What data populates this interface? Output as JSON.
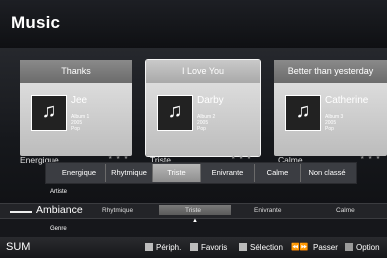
{
  "header": {
    "title": "Music"
  },
  "cards": [
    {
      "title": "Thanks",
      "artist": "Jee",
      "album": "Album 1",
      "year": "2005",
      "genre": "Pop",
      "mood": "Energique",
      "stars": "★ ★ ★"
    },
    {
      "title": "I Love You",
      "artist": "Darby",
      "album": "Album 2",
      "year": "2005",
      "genre": "Pop",
      "mood": "Triste",
      "stars": "★ ★ ★",
      "selected": true
    },
    {
      "title": "Better than yesterday",
      "artist": "Catherine",
      "album": "Album 3",
      "year": "2005",
      "genre": "Pop",
      "mood": "Calme",
      "stars": "★ ★ ★"
    }
  ],
  "mood_popup": {
    "options": [
      "Energique",
      "Rhytmique",
      "Triste",
      "Enivrante",
      "Calme",
      "Non classé"
    ],
    "selected": "Triste"
  },
  "category_selector": {
    "above": "Artiste",
    "current": "Ambiance",
    "below": "Genre",
    "bar_options": [
      "Rhytmique",
      "Triste",
      "Enivrante",
      "Calme"
    ],
    "bar_selected": "Triste",
    "arrow": "▲"
  },
  "footer": {
    "left": "SUM",
    "hints": [
      {
        "icon": "red-button-icon",
        "label": "Périph."
      },
      {
        "icon": "green-button-icon",
        "label": "Favoris"
      },
      {
        "icon": "yellow-button-icon",
        "label": "Sélection"
      },
      {
        "icon": "skip-buttons-icon",
        "label": "Passer"
      },
      {
        "icon": "tools-icon",
        "label": "Option"
      }
    ]
  },
  "colors": {
    "accent_selected": "#b6b6b6",
    "background": "#16171b"
  }
}
